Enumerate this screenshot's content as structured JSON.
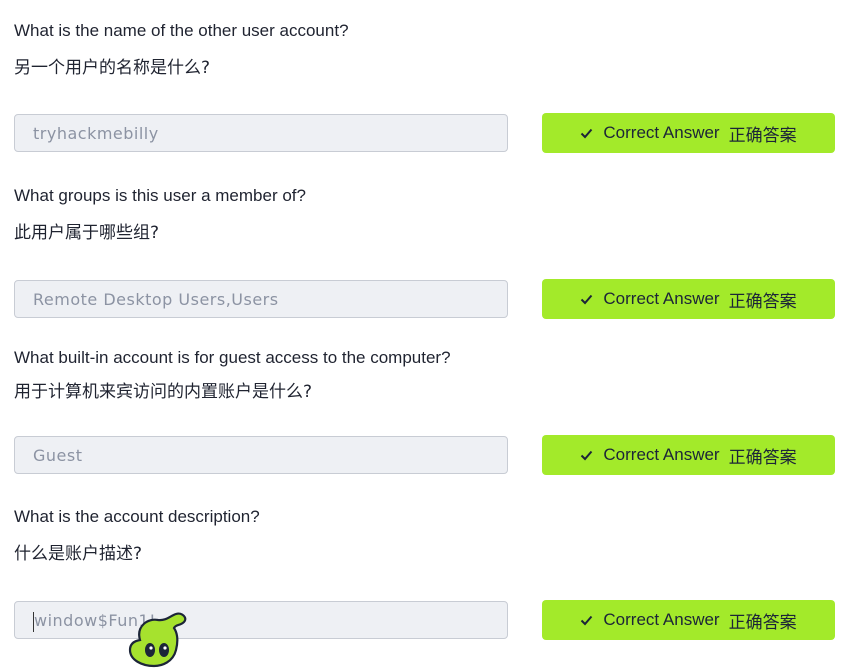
{
  "questions": [
    {
      "en": "What is the name of the other user account?",
      "zh": "另一个用户的名称是什么?",
      "answer": "tryhackmebilly",
      "button": {
        "label_en": "Correct Answer",
        "label_zh": "正确答案"
      }
    },
    {
      "en": "What groups is this user a member of?",
      "zh": "此用户属于哪些组?",
      "answer": "Remote Desktop Users,Users",
      "button": {
        "label_en": "Correct Answer",
        "label_zh": "正确答案"
      }
    },
    {
      "en": "What built-in account is for guest access to the computer?",
      "zh": "用于计算机来宾访问的内置账户是什么?",
      "answer": "Guest",
      "button": {
        "label_en": "Correct Answer",
        "label_zh": "正确答案"
      }
    },
    {
      "en": "What is the account description?",
      "zh": "什么是账户描述?",
      "answer": "window$Fun1!",
      "button": {
        "label_en": "Correct Answer",
        "label_zh": "正确答案"
      }
    }
  ],
  "colors": {
    "button_bg": "#a3ea2a",
    "input_bg": "#eef0f4",
    "input_text": "#8c93a3"
  },
  "icons": [
    "check-icon",
    "mascot-icon"
  ]
}
